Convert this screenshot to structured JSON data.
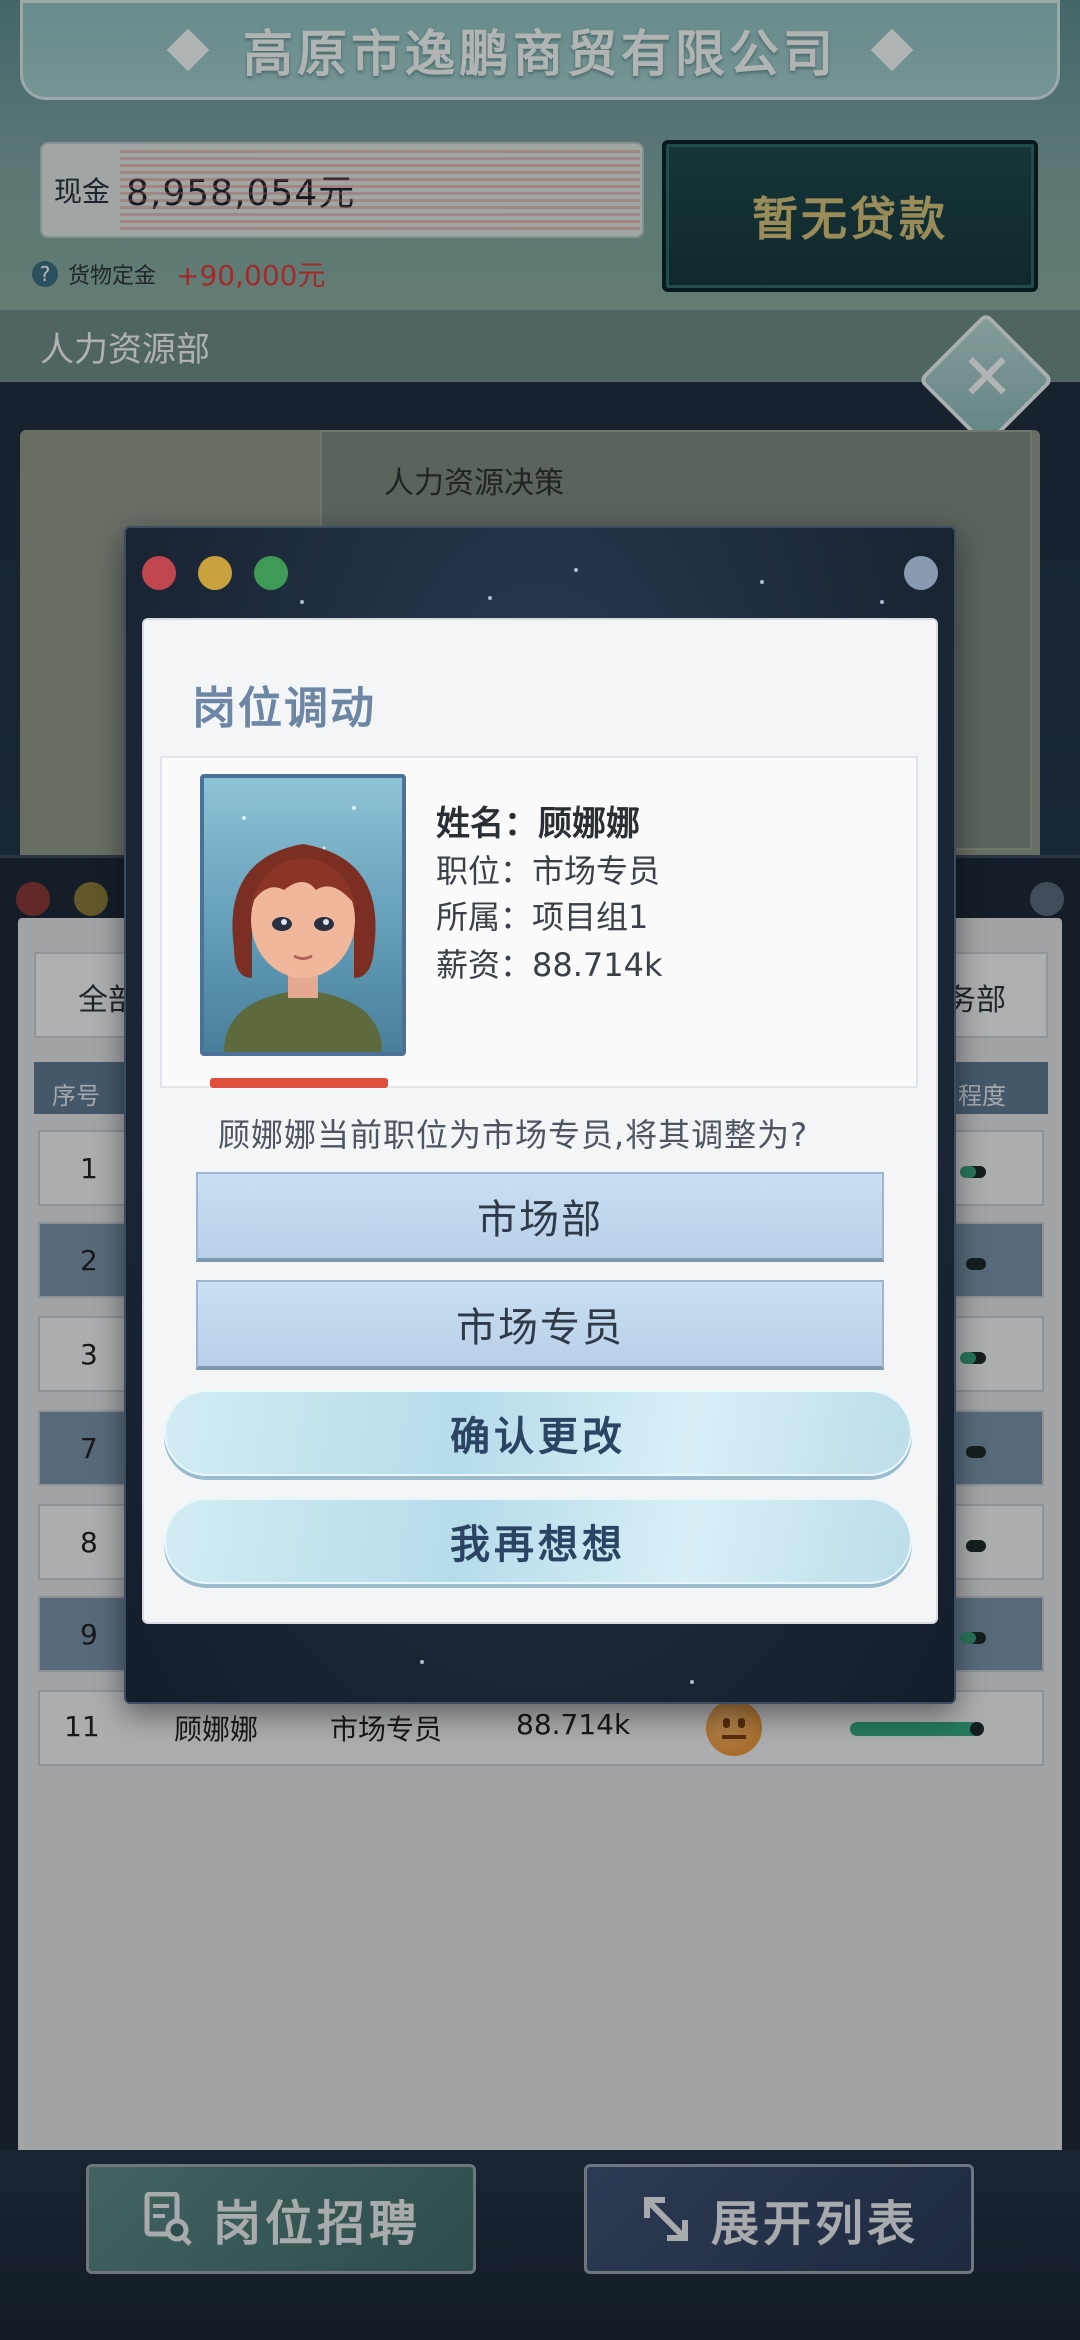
{
  "company": {
    "name": "高原市逸鹏商贸有限公司"
  },
  "finance": {
    "cash_label": "现金",
    "cash_value": "8,958,054元",
    "deposit_label": "货物定金",
    "deposit_value": "+90,000元",
    "loan_label": "暂无贷款"
  },
  "department": {
    "title": "人力资源部",
    "decision_title": "人力资源决策"
  },
  "list": {
    "tab_all": "全部",
    "tab_right": "务部",
    "col_index": "序号",
    "col_progress": "程度",
    "rows": [
      "1",
      "2",
      "3",
      "7",
      "8",
      "9"
    ],
    "last_row": {
      "index": "11",
      "name": "顾娜娜",
      "role": "市场专员",
      "salary": "88.714k"
    }
  },
  "modal": {
    "title": "岗位调动",
    "name_line": "姓名：顾娜娜",
    "role_line": "职位：市场专员",
    "group_line": "所属：项目组1",
    "salary_line": "薪资：88.714k",
    "question": "顾娜娜当前职位为市场专员,将其调整为?",
    "dept_select": "市场部",
    "role_select": "市场专员",
    "confirm_label": "确认更改",
    "rethink_label": "我再想想"
  },
  "bottom": {
    "recruit_label": "岗位招聘",
    "expand_label": "展开列表"
  },
  "colors": {
    "accent": "#6d86a4",
    "danger": "#e03b3b",
    "loan_text": "#d5c27a",
    "progress": "#35a882"
  },
  "icons": {
    "help": "help-icon",
    "close": "close-icon",
    "recruit": "search-document-icon",
    "expand": "expand-arrows-icon",
    "mood": "neutral-face-icon"
  }
}
